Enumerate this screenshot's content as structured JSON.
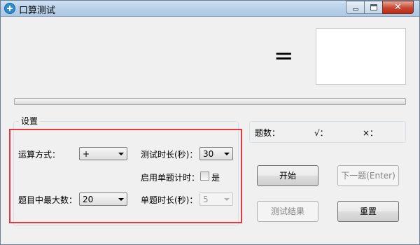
{
  "window": {
    "title": "口算测试",
    "controls": {
      "close_glyph": "✕"
    }
  },
  "question": {
    "equals_sign": "=",
    "answer_value": ""
  },
  "progress": {
    "value": 0
  },
  "settings": {
    "group_title": "设置",
    "operation": {
      "label": "运算方式：",
      "value": "+"
    },
    "duration": {
      "label": "测试时长(秒)：",
      "value": "30"
    },
    "per_question_timer": {
      "label": "启用单题计时：",
      "checkbox_label": "是",
      "checked": false
    },
    "max_number": {
      "label": "题目中最大数：",
      "value": "20"
    },
    "per_question_duration": {
      "label": "单题时长(秒)：",
      "value": "5"
    }
  },
  "stats": {
    "count_label": "题数：",
    "correct_label": "√：",
    "wrong_label": "×："
  },
  "buttons": {
    "start": "开始",
    "next": "下一题(Enter)",
    "results": "测试结果",
    "reset": "重置"
  },
  "colors": {
    "highlight": "#e8383d",
    "window_bg": "#f0f0f0"
  }
}
